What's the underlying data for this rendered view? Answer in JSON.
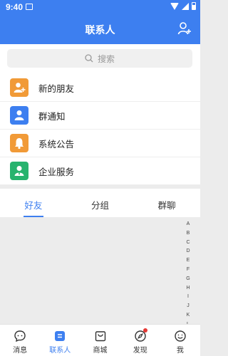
{
  "status": {
    "time": "9:40"
  },
  "header": {
    "title": "联系人"
  },
  "search": {
    "placeholder": "搜索"
  },
  "menu": [
    {
      "label": "新的朋友",
      "icon": "new-friend-icon",
      "color": "#f19a37"
    },
    {
      "label": "群通知",
      "icon": "group-notice-icon",
      "color": "#3d7ff0"
    },
    {
      "label": "系统公告",
      "icon": "announcement-icon",
      "color": "#f19a37"
    },
    {
      "label": "企业服务",
      "icon": "enterprise-service-icon",
      "color": "#27b36e"
    }
  ],
  "tabs": [
    {
      "label": "好友",
      "active": true
    },
    {
      "label": "分组",
      "active": false
    },
    {
      "label": "群聊",
      "active": false
    }
  ],
  "index_letters": [
    "A",
    "B",
    "C",
    "D",
    "E",
    "F",
    "G",
    "H",
    "I",
    "J",
    "K",
    "L"
  ],
  "bottom_nav": [
    {
      "label": "消息",
      "icon": "message-icon",
      "active": false
    },
    {
      "label": "联系人",
      "icon": "contacts-icon",
      "active": true
    },
    {
      "label": "商城",
      "icon": "mall-icon",
      "active": false
    },
    {
      "label": "发现",
      "icon": "discover-icon",
      "active": false,
      "badge": true
    },
    {
      "label": "我",
      "icon": "profile-icon",
      "active": false
    }
  ],
  "colors": {
    "primary": "#3d7ff0",
    "orange": "#f19a37",
    "green": "#27b36e",
    "badge": "#e53935"
  }
}
